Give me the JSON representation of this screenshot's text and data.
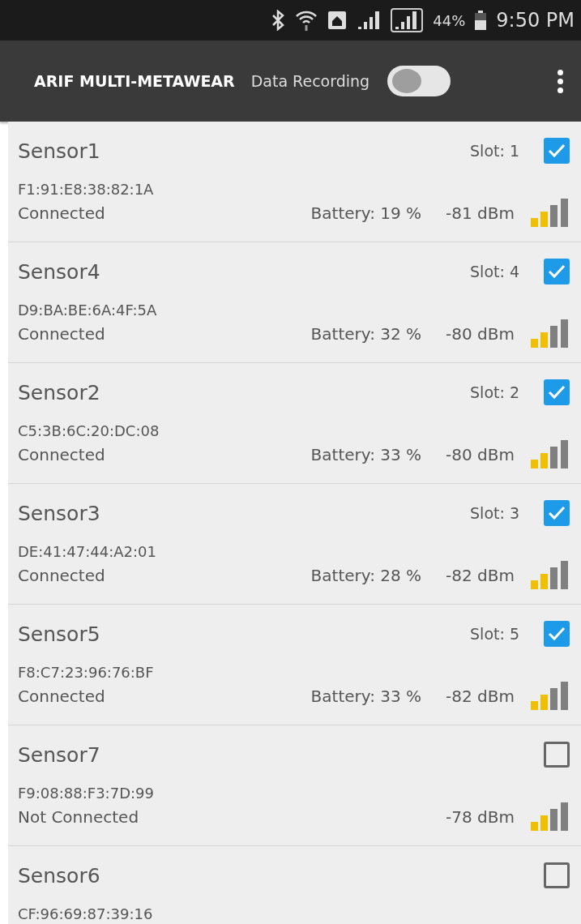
{
  "status_bar": {
    "battery": "44%",
    "time": "9:50 PM"
  },
  "app_bar": {
    "title": "ARIF MULTI-METAWEAR",
    "recording_label": "Data Recording",
    "recording_on": false
  },
  "sensors": [
    {
      "name": "Sensor1",
      "slot": "Slot: 1",
      "checked": true,
      "address": "F1:91:E8:38:82:1A",
      "status": "Connected",
      "battery": "Battery: 19 %",
      "rssi": "-81 dBm"
    },
    {
      "name": "Sensor4",
      "slot": "Slot: 4",
      "checked": true,
      "address": "D9:BA:BE:6A:4F:5A",
      "status": "Connected",
      "battery": "Battery: 32 %",
      "rssi": "-80 dBm"
    },
    {
      "name": "Sensor2",
      "slot": "Slot: 2",
      "checked": true,
      "address": "C5:3B:6C:20:DC:08",
      "status": "Connected",
      "battery": "Battery: 33 %",
      "rssi": "-80 dBm"
    },
    {
      "name": "Sensor3",
      "slot": "Slot: 3",
      "checked": true,
      "address": "DE:41:47:44:A2:01",
      "status": "Connected",
      "battery": "Battery: 28 %",
      "rssi": "-82 dBm"
    },
    {
      "name": "Sensor5",
      "slot": "Slot: 5",
      "checked": true,
      "address": "F8:C7:23:96:76:BF",
      "status": "Connected",
      "battery": "Battery: 33 %",
      "rssi": "-82 dBm"
    },
    {
      "name": "Sensor7",
      "checked": false,
      "address": "F9:08:88:F3:7D:99",
      "status": "Not Connected",
      "rssi": "-78 dBm"
    },
    {
      "name": "Sensor6",
      "checked": false,
      "address": "CF:96:69:87:39:16"
    }
  ]
}
